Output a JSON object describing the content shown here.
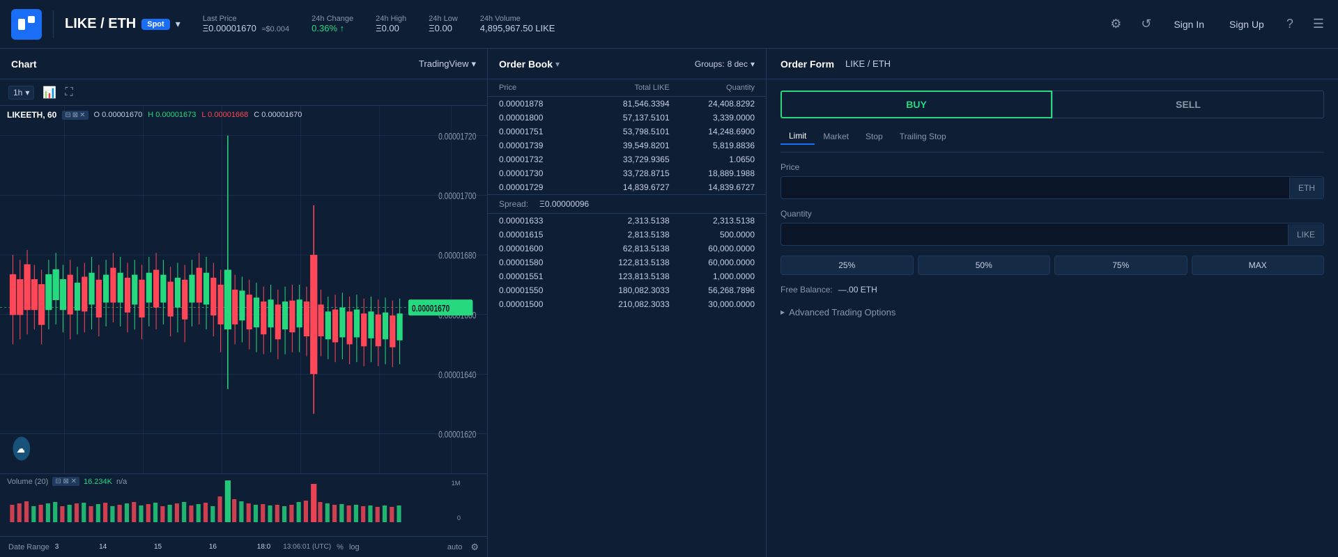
{
  "header": {
    "logo": "L",
    "pair": "LIKE / ETH",
    "spot_badge": "Spot",
    "last_price_label": "Last Price",
    "last_price_value": "Ξ0.00001670",
    "last_price_usd": "≈$0.004",
    "change_label": "24h Change",
    "change_value": "0.36%",
    "change_arrow": "↑",
    "high_label": "24h High",
    "high_value": "Ξ0.00",
    "low_label": "24h Low",
    "low_value": "Ξ0.00",
    "volume_label": "24h Volume",
    "volume_value": "4,895,967.50 LIKE",
    "sign_in": "Sign In",
    "sign_up": "Sign Up"
  },
  "chart": {
    "title": "Chart",
    "tradingview_btn": "TradingView",
    "timeframe": "1h",
    "symbol": "LIKEETH, 60",
    "ohlc": {
      "o_label": "O",
      "o_value": "0.00001670",
      "h_label": "H",
      "h_value": "0.00001673",
      "l_label": "L",
      "l_value": "0.00001668",
      "c_label": "C",
      "c_value": "0.00001670"
    },
    "price_levels": [
      "0.00001720",
      "0.00001700",
      "0.00001680",
      "0.00001660",
      "0.00001640",
      "0.00001620"
    ],
    "current_price": "0.00001670",
    "volume_label": "Volume (20)",
    "volume_value": "16.234K",
    "volume_extra": "n/a",
    "x_labels": [
      "3",
      "14",
      "15",
      "16",
      "18:0"
    ],
    "bottom_left": {
      "date_range": "Date Range",
      "time": "13:06:01 (UTC)",
      "pct": "%",
      "log": "log"
    },
    "bottom_right": {
      "auto": "auto"
    }
  },
  "orderbook": {
    "title": "Order Book",
    "groups_label": "Groups:",
    "groups_value": "8 dec",
    "col_price": "Price",
    "col_total": "Total LIKE",
    "col_quantity": "Quantity",
    "sell_orders": [
      {
        "price": "0.00001878",
        "total": "81,546.3394",
        "quantity": "24,408.8292"
      },
      {
        "price": "0.00001800",
        "total": "57,137.5101",
        "quantity": "3,339.0000"
      },
      {
        "price": "0.00001751",
        "total": "53,798.5101",
        "quantity": "14,248.6900"
      },
      {
        "price": "0.00001739",
        "total": "39,549.8201",
        "quantity": "5,819.8836"
      },
      {
        "price": "0.00001732",
        "total": "33,729.9365",
        "quantity": "1.0650"
      },
      {
        "price": "0.00001730",
        "total": "33,728.8715",
        "quantity": "18,889.1988"
      },
      {
        "price": "0.00001729",
        "total": "14,839.6727",
        "quantity": "14,839.6727"
      }
    ],
    "spread_label": "Spread:",
    "spread_value": "Ξ0.00000096",
    "buy_orders": [
      {
        "price": "0.00001633",
        "total": "2,313.5138",
        "quantity": "2,313.5138"
      },
      {
        "price": "0.00001615",
        "total": "2,813.5138",
        "quantity": "500.0000"
      },
      {
        "price": "0.00001600",
        "total": "62,813.5138",
        "quantity": "60,000.0000"
      },
      {
        "price": "0.00001580",
        "total": "122,813.5138",
        "quantity": "60,000.0000"
      },
      {
        "price": "0.00001551",
        "total": "123,813.5138",
        "quantity": "1,000.0000"
      },
      {
        "price": "0.00001550",
        "total": "180,082.3033",
        "quantity": "56,268.7896"
      },
      {
        "price": "0.00001500",
        "total": "210,082.3033",
        "quantity": "30,000.0000"
      }
    ],
    "volume_labels": [
      "1M",
      "0"
    ]
  },
  "orderform": {
    "title": "Order Form",
    "pair": "LIKE / ETH",
    "buy_label": "BUY",
    "sell_label": "SELL",
    "order_types": [
      "Limit",
      "Market",
      "Stop",
      "Trailing Stop"
    ],
    "active_order_type": "Limit",
    "price_label": "Price",
    "price_unit": "ETH",
    "quantity_label": "Quantity",
    "quantity_unit": "LIKE",
    "pct_buttons": [
      "25%",
      "50%",
      "75%",
      "MAX"
    ],
    "free_balance_label": "Free Balance:",
    "free_balance_value": "—.00 ETH",
    "advanced_options": "Advanced Trading Options"
  }
}
